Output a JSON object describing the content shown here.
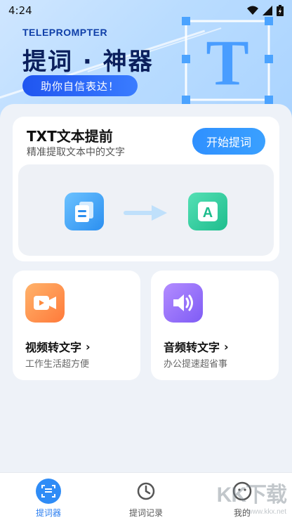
{
  "status": {
    "time": "4:24"
  },
  "hero": {
    "brand_en": "TELEPROMPTER",
    "title": "提词 · 神器",
    "tagline": "助你自信表达！"
  },
  "txt_card": {
    "title": "TXT文本提前",
    "subtitle": "精准提取文本中的文字",
    "start_button": "开始提词",
    "from_icon": "document-stack-icon",
    "to_icon": "letter-a-icon"
  },
  "features": [
    {
      "label": "视频转文字",
      "desc": "工作生活超方便",
      "icon": "video-camera-icon",
      "color": "#ff8a3d"
    },
    {
      "label": "音频转文字",
      "desc": "办公提速超省事",
      "icon": "speaker-icon",
      "color": "#8f6bff"
    }
  ],
  "tabs": [
    {
      "label": "提词器",
      "icon": "teleprompter-icon",
      "active": true
    },
    {
      "label": "提词记录",
      "icon": "history-clock-icon",
      "active": false
    },
    {
      "label": "我的",
      "icon": "profile-icon",
      "active": false
    }
  ],
  "watermark": {
    "main": "KK下载",
    "sub": "www.kkx.net"
  }
}
